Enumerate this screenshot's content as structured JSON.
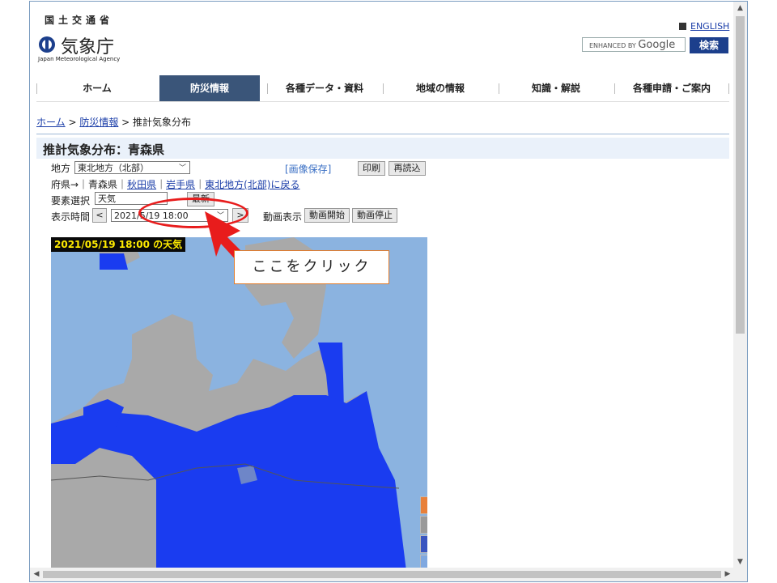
{
  "header": {
    "ministry": "国土交通省",
    "agency": "気象庁",
    "agency_en": "Japan Meteorological Agency",
    "english_link": "ENGLISH",
    "search_placeholder": "ENHANCED BY",
    "search_brand": "Google",
    "search_button": "検索"
  },
  "nav": {
    "items": [
      "ホーム",
      "防災情報",
      "各種データ・資料",
      "地域の情報",
      "知識・解説",
      "各種申請・ご案内"
    ],
    "active_index": 1,
    "active_color": "#3a5579"
  },
  "breadcrumb": {
    "home": "ホーム",
    "sep1": " > ",
    "disaster": "防災情報",
    "sep2": " > ",
    "current": "推計気象分布"
  },
  "page": {
    "title": "推計気象分布：青森県"
  },
  "controls": {
    "region_label": "地方",
    "region_value": "東北地方（北部）",
    "save_image": "[画像保存]",
    "print_button": "印刷",
    "reload_button": "再読込",
    "pref_prefix": "府県→｜青森県｜",
    "pref_akita": "秋田県",
    "pref_sep1": "｜",
    "pref_iwate": "岩手県",
    "pref_sep2": "｜",
    "pref_back": "東北地方(北部)に戻る",
    "element_label": "要素選択",
    "element_value": "天気",
    "latest_button": "最新",
    "time_label": "表示時間",
    "prev_button": "<",
    "time_value": "2021/5/19 18:00",
    "next_button": ">",
    "anim_label": "動画表示",
    "anim_start": "動画開始",
    "anim_stop": "動画停止"
  },
  "map": {
    "label": "2021/05/19 18:00 の天気",
    "sea_color": "#8bb3e0",
    "land_color": "#a9a9a9",
    "rain_color": "#1a3cf0"
  },
  "annotation": {
    "text": "ここをクリック",
    "color": "#e81c1c"
  }
}
